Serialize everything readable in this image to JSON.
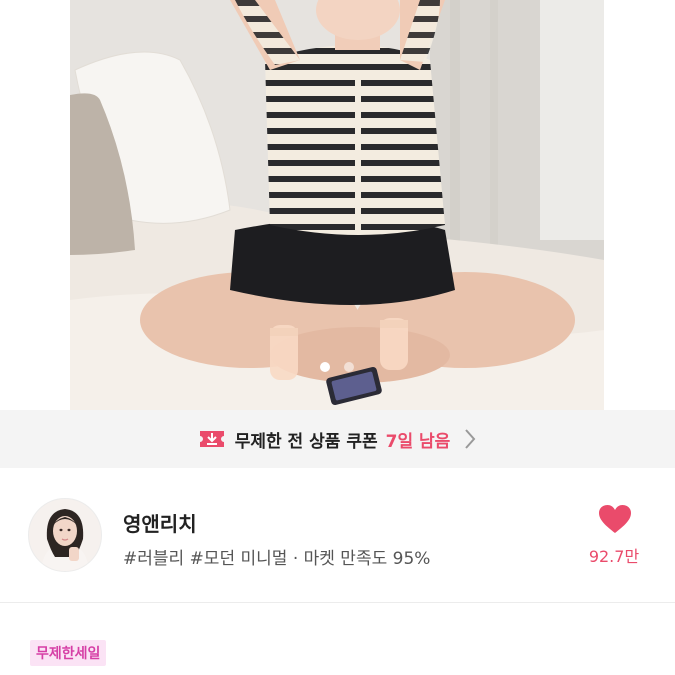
{
  "carousel": {
    "total_slides": 2,
    "active_index": 0
  },
  "coupon": {
    "text": "무제한 전 상품 쿠폰",
    "days_left": "7일 남음",
    "icon": "coupon-ticket-icon",
    "accent_color": "#ea4b6b"
  },
  "shop": {
    "name": "영앤리치",
    "tags": "#러블리 #모던 미니멀 · 마켓 만족도 95%",
    "like_count": "92.7만",
    "heart_icon": "heart-icon",
    "heart_color": "#ea4b6b"
  },
  "badge": {
    "label": "무제한세일",
    "bg": "#fbe3f5",
    "color": "#d63fa6"
  }
}
